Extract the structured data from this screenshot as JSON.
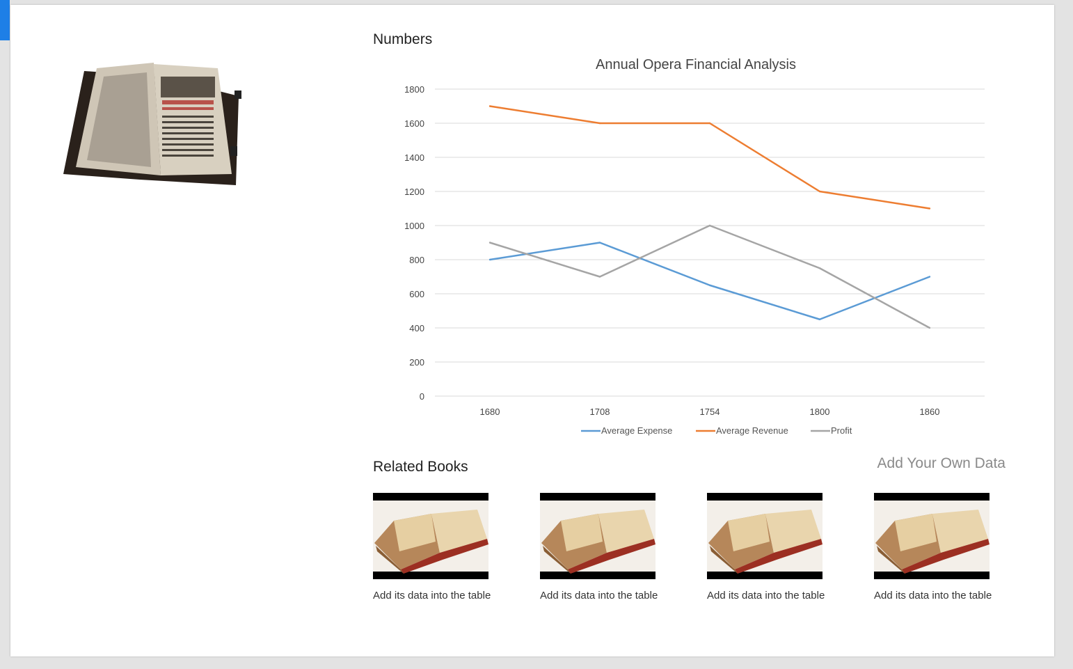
{
  "sections": {
    "numbers_title": "Numbers",
    "related_title": "Related Books",
    "add_data_link": "Add Your Own Data"
  },
  "chart_data": {
    "type": "line",
    "title": "Annual Opera Financial Analysis",
    "categories": [
      "1680",
      "1708",
      "1754",
      "1800",
      "1860"
    ],
    "series": [
      {
        "name": "Average Expense",
        "color": "#5b9bd5",
        "values": [
          800,
          900,
          650,
          450,
          700
        ]
      },
      {
        "name": "Average Revenue",
        "color": "#ed7d31",
        "values": [
          1700,
          1600,
          1600,
          1200,
          1100
        ]
      },
      {
        "name": "Profit",
        "color": "#a5a5a5",
        "values": [
          900,
          700,
          1000,
          750,
          400
        ]
      }
    ],
    "ylim": [
      0,
      1800
    ],
    "yticks": [
      0,
      200,
      400,
      600,
      800,
      1000,
      1200,
      1400,
      1600,
      1800
    ],
    "grid": true,
    "legend": "bottom"
  },
  "related_books": [
    {
      "caption": "Add its data into the table"
    },
    {
      "caption": "Add its data into the table"
    },
    {
      "caption": "Add its data into the table"
    },
    {
      "caption": "Add its data into the table"
    }
  ]
}
